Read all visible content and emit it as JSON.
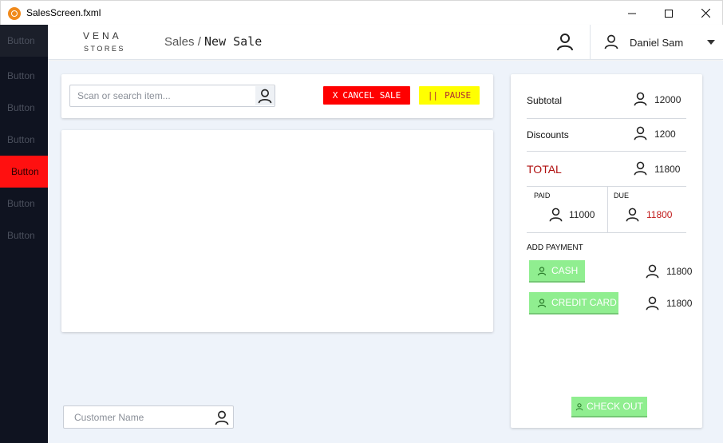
{
  "window": {
    "title": "SalesScreen.fxml",
    "controls": [
      "minimize-icon",
      "maximize-icon",
      "close-icon"
    ]
  },
  "sidebar": {
    "items": [
      {
        "label": "Button"
      },
      {
        "label": "Button"
      },
      {
        "label": "Button"
      },
      {
        "label": "Button"
      },
      {
        "label": "Button",
        "active": true
      },
      {
        "label": "Button"
      },
      {
        "label": "Button"
      }
    ]
  },
  "header": {
    "logo_main": "VENA",
    "logo_sub": "STORES",
    "breadcrumb_parent": "Sales /",
    "breadcrumb_current": "New Sale",
    "user_name": "Daniel Sam"
  },
  "toolbar": {
    "search_placeholder": "Scan or search item...",
    "cancel_icon": "X",
    "cancel_label": "CANCEL SALE",
    "pause_icon": "||",
    "pause_label": "PAUSE"
  },
  "customer": {
    "placeholder": "Customer Name"
  },
  "summary": {
    "subtotal_label": "Subtotal",
    "subtotal_value": "12000",
    "discounts_label": "Discounts",
    "discounts_value": "1200",
    "total_label": "TOTAL",
    "total_value": "11800",
    "paid_label": "PAID",
    "paid_value": "11000",
    "due_label": "DUE",
    "due_value": "11800",
    "add_payment_label": "ADD PAYMENT",
    "payments": [
      {
        "label": "CASH",
        "amount": "11800"
      },
      {
        "label": "CREDIT CARD",
        "amount": "11800"
      }
    ],
    "checkout_label": "CHECK OUT"
  },
  "colors": {
    "sidebar_bg": "#0f1320",
    "active_item": "#ff1010",
    "cancel_button": "#ff0000",
    "pause_button": "#ffff00",
    "pay_button": "#90ee90",
    "total_text": "#b01010",
    "content_bg": "#eef3fa"
  },
  "icons": {
    "user": "user-icon",
    "search": "user-icon"
  }
}
